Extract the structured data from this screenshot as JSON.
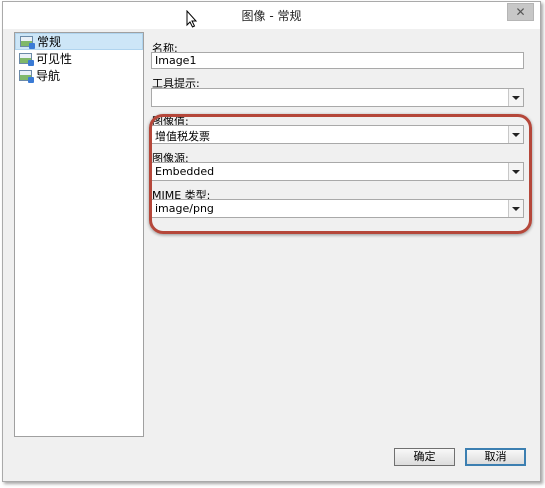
{
  "window": {
    "title": "图像 - 常规"
  },
  "nav": {
    "items": [
      {
        "label": "常规",
        "selected": true
      },
      {
        "label": "可见性",
        "selected": false
      },
      {
        "label": "导航",
        "selected": false
      }
    ]
  },
  "form": {
    "name_label": "名称:",
    "name_value": "Image1",
    "tooltip_label": "工具提示:",
    "tooltip_value": "",
    "image_value_label": "图像值:",
    "image_value": "增值税发票",
    "image_source_label": "图像源:",
    "image_source": "Embedded",
    "mime_label": "MIME 类型:",
    "mime_value": "image/png"
  },
  "buttons": {
    "ok": "确定",
    "cancel": "取消"
  },
  "colors": {
    "highlight": "#b5473a",
    "selection": "#cde6f7"
  }
}
